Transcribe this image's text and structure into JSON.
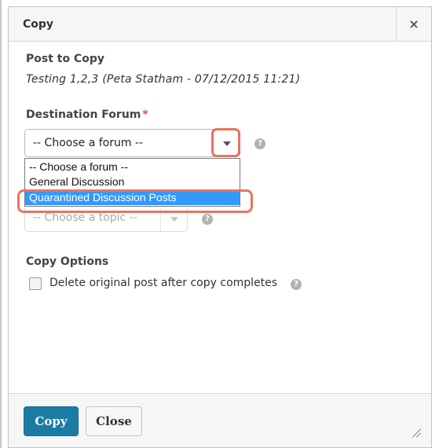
{
  "dialog": {
    "title": "Copy",
    "close_symbol": "×"
  },
  "post": {
    "label": "Post to Copy",
    "value": "Testing 1,2,3 (Peta Statham - 07/12/2015 11:21)"
  },
  "forum": {
    "label": "Destination Forum",
    "required_mark": "*",
    "selected": "-- Choose a forum --",
    "options": [
      "-- Choose a forum --",
      "General Discussion",
      "Quarantined Discussion Posts"
    ],
    "highlighted_option": "Quarantined Discussion Posts"
  },
  "topic": {
    "selected": "-- Choose a topic --"
  },
  "copy_options": {
    "label": "Copy Options",
    "delete_original_label": "Delete original post after copy completes",
    "delete_original_checked": false
  },
  "help_symbol": "?",
  "footer": {
    "copy_label": "Copy",
    "close_label": "Close"
  },
  "colors": {
    "primary_button": "#1b7ba5",
    "highlight_ring": "#e8735f",
    "selected_option": "#3399ff",
    "required": "#d9534f"
  }
}
